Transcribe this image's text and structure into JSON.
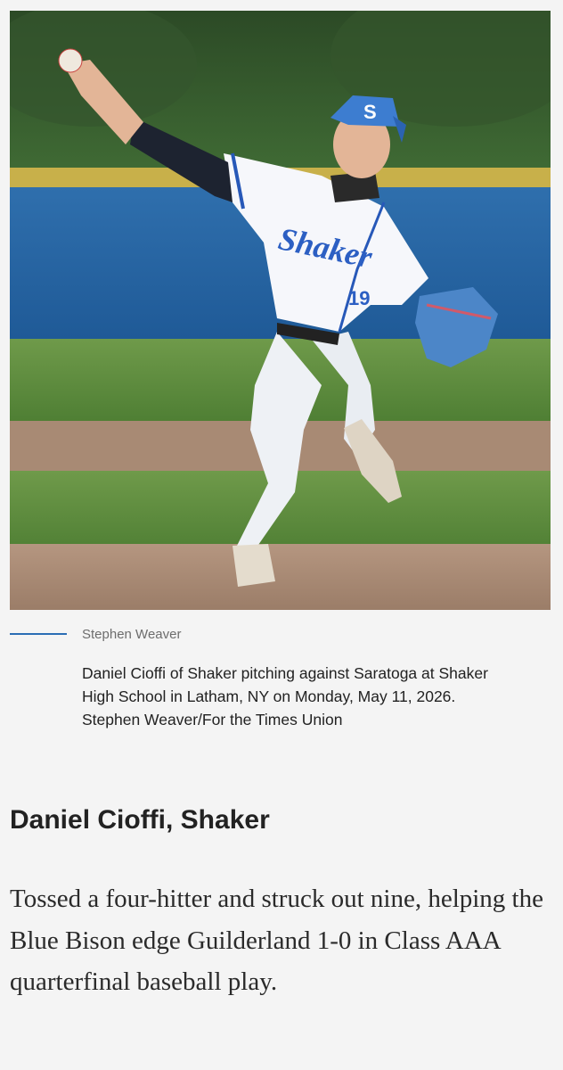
{
  "photo": {
    "description_icon": "photo-baseball-pitcher",
    "cap_letter": "S",
    "jersey_text": "Shaker",
    "jersey_number": "19"
  },
  "credit": {
    "photographer": "Stephen Weaver"
  },
  "caption": {
    "text": "Daniel Cioffi of Shaker pitching against Saratoga at Shaker High School in Latham, NY on Monday, May 11, 2026. Stephen Weaver/For the Times Union"
  },
  "article": {
    "headline": "Daniel Cioffi, Shaker",
    "blurb": "Tossed a four-hitter and struck out nine, helping the Blue Bison edge Guilderland 1-0 in Class AAA quarterfinal baseball play."
  },
  "colors": {
    "accent": "#2a6db4",
    "background": "#f4f4f4",
    "text": "#222222"
  }
}
